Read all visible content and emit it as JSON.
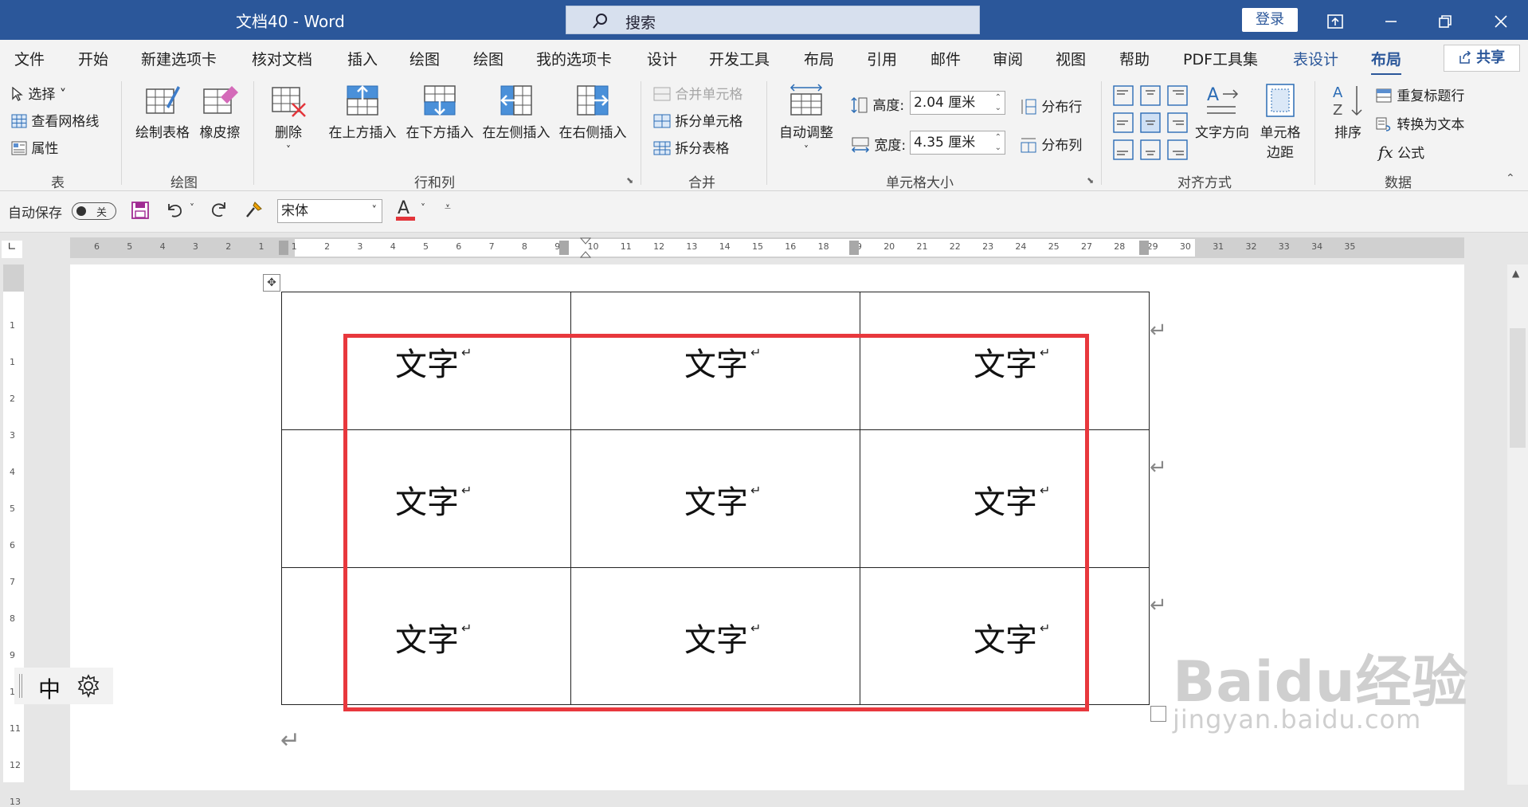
{
  "window": {
    "title": "文档40  -  Word",
    "search_placeholder": "搜索",
    "login": "登录"
  },
  "tabs": [
    "文件",
    "开始",
    "新建选项卡",
    "核对文档",
    "插入",
    "绘图",
    "绘图",
    "我的选项卡",
    "设计",
    "开发工具",
    "布局",
    "引用",
    "邮件",
    "审阅",
    "视图",
    "帮助",
    "PDF工具集",
    "表设计",
    "布局"
  ],
  "share": "共享",
  "ribbon": {
    "table_group": {
      "label": "表",
      "select": "选择",
      "gridlines": "查看网格线",
      "properties": "属性"
    },
    "draw_group": {
      "label": "绘图",
      "draw_table": "绘制表格",
      "eraser": "橡皮擦"
    },
    "rows_cols": {
      "label": "行和列",
      "delete": "删除",
      "insert_above": "在上方插入",
      "insert_below": "在下方插入",
      "insert_left": "在左侧插入",
      "insert_right": "在右侧插入"
    },
    "merge": {
      "label": "合并",
      "merge_cells": "合并单元格",
      "split_cells": "拆分单元格",
      "split_table": "拆分表格"
    },
    "cell_size": {
      "label": "单元格大小",
      "autofit": "自动调整",
      "height_label": "高度:",
      "height_value": "2.04 厘米",
      "width_label": "宽度:",
      "width_value": "4.35 厘米",
      "distribute_rows": "分布行",
      "distribute_cols": "分布列"
    },
    "alignment": {
      "label": "对齐方式",
      "text_direction": "文字方向",
      "cell_margins_1": "单元格",
      "cell_margins_2": "边距"
    },
    "data": {
      "label": "数据",
      "sort": "排序",
      "repeat_header": "重复标题行",
      "convert_text": "转换为文本",
      "formula": "公式"
    }
  },
  "qat": {
    "autosave": "自动保存",
    "autosave_state": "关",
    "font": "宋体"
  },
  "hruler_numbers": [
    "6",
    "5",
    "4",
    "3",
    "2",
    "1",
    "1",
    "2",
    "3",
    "4",
    "5",
    "6",
    "7",
    "8",
    "9",
    "10",
    "11",
    "12",
    "13",
    "14",
    "15",
    "16",
    "18",
    "19",
    "20",
    "21",
    "22",
    "23",
    "24",
    "25",
    "27",
    "28",
    "29",
    "30",
    "31",
    "32",
    "33",
    "34",
    "35"
  ],
  "vruler_numbers": [
    "1",
    "1",
    "2",
    "3",
    "4",
    "5",
    "6",
    "7",
    "8",
    "9",
    "10",
    "11",
    "12",
    "13"
  ],
  "table": {
    "rows": [
      [
        "文字",
        "文字",
        "文字"
      ],
      [
        "文字",
        "文字",
        "文字"
      ],
      [
        "文字",
        "文字",
        "文字"
      ]
    ]
  },
  "ime": {
    "mode": "中"
  },
  "watermark": {
    "brand": "Baidu经验",
    "url": "jingyan.baidu.com"
  },
  "colors": {
    "word_blue": "#2b579a",
    "highlight_red": "#e8383d"
  }
}
